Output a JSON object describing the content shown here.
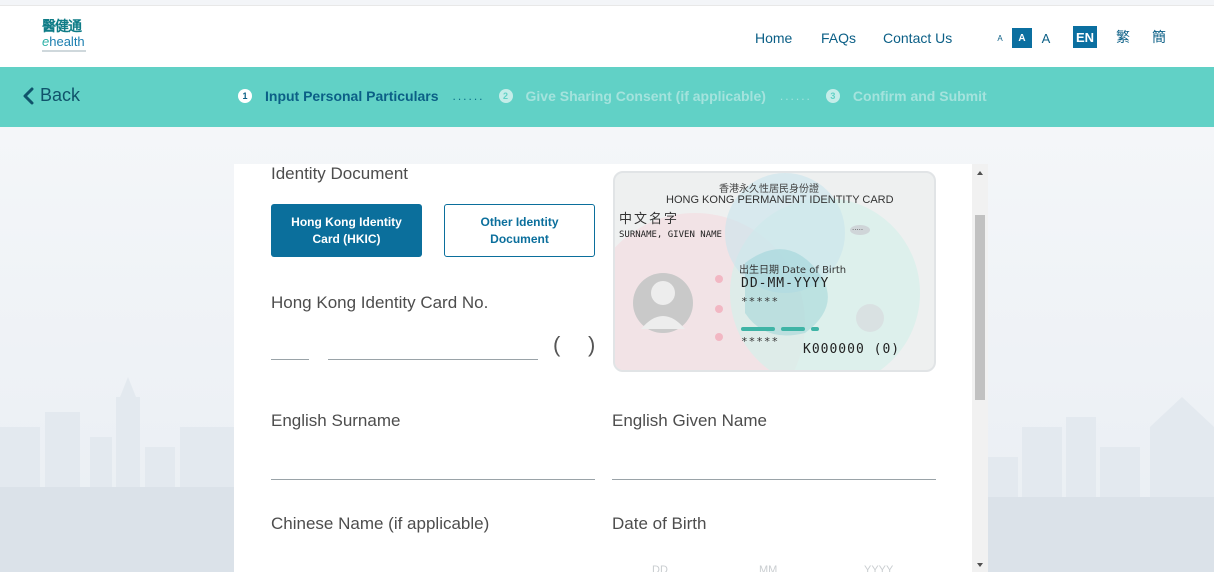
{
  "header": {
    "logo_cn": "醫健通",
    "logo_en_prefix": "e",
    "logo_en": "health",
    "nav": {
      "home": "Home",
      "faqs": "FAQs",
      "contact": "Contact Us"
    },
    "font_size": {
      "small": "A",
      "medium": "A",
      "large": "A"
    },
    "lang": {
      "en": "EN",
      "tc": "繁",
      "sc": "簡"
    }
  },
  "stepbar": {
    "back_label": "Back",
    "steps": [
      {
        "num": "1",
        "label": "Input Personal Particulars"
      },
      {
        "num": "2",
        "label": "Give Sharing Consent (if applicable)"
      },
      {
        "num": "3",
        "label": "Confirm and Submit"
      }
    ],
    "dots": "......"
  },
  "form": {
    "identity_document_label": "Identity Document",
    "doc_options": [
      "Hong Kong Identity Card (HKIC)",
      "Other Identity Document"
    ],
    "hkic_no_label": "Hong Kong Identity Card No.",
    "english_surname_label": "English Surname",
    "english_given_name_label": "English Given Name",
    "chinese_name_label": "Chinese Name (if applicable)",
    "dob_label": "Date of Birth",
    "dob_placeholders": [
      "DD",
      "MM",
      "YYYY"
    ]
  },
  "id_card_sample": {
    "title_cn": "香港永久性居民身份證",
    "title_en": "HONG KONG PERMANENT IDENTITY CARD",
    "chinese_name": "中文名字",
    "surname_given": "SURNAME, GIVEN NAME",
    "dob_label": "出生日期 Date of Birth",
    "dob_value": "DD-MM-YYYY",
    "stars1": "*****",
    "stars2": "*****",
    "id_number": "K000000 (0)",
    "chip": "....."
  },
  "colors": {
    "primary": "#0b6f9c",
    "teal": "#61d1c6",
    "nav_text": "#0b5f86"
  }
}
